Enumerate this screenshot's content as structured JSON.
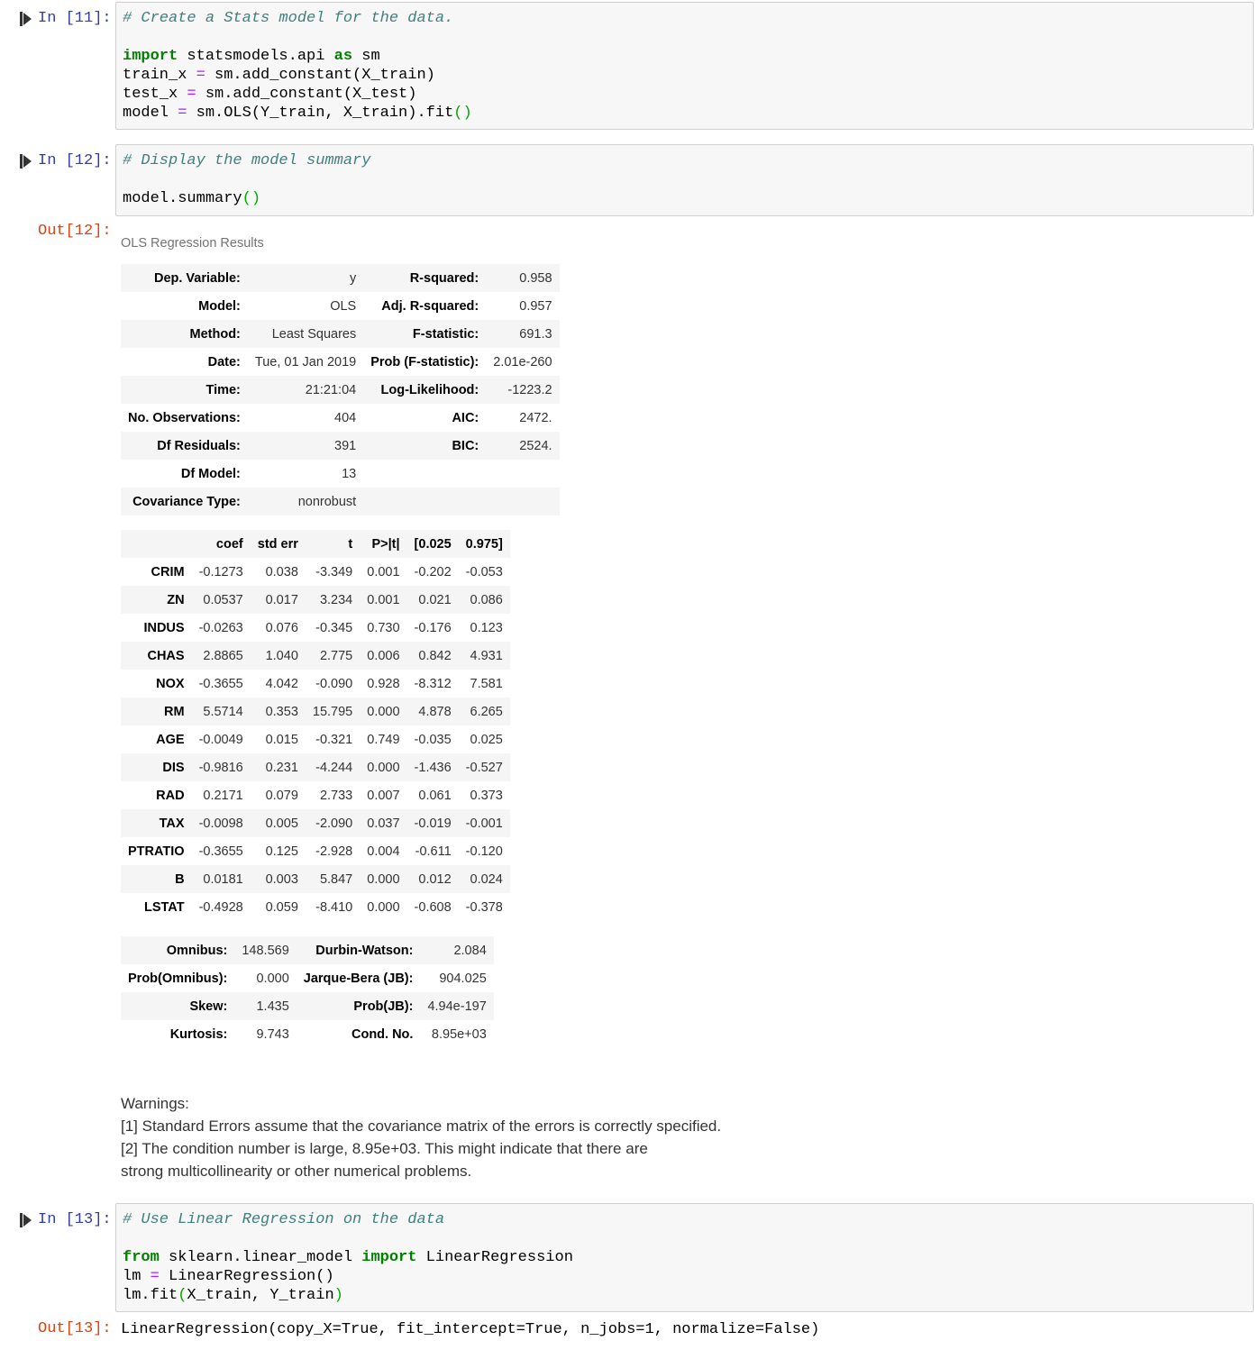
{
  "cells": {
    "c11": {
      "prompt": "In [11]:",
      "lines": [
        {
          "segments": [
            {
              "t": "# Create a Stats model for the data.",
              "c": "cm-comment"
            }
          ]
        },
        {
          "segments": []
        },
        {
          "segments": [
            {
              "t": "import",
              "c": "cm-kw"
            },
            {
              "t": " statsmodels.api ",
              "c": ""
            },
            {
              "t": "as",
              "c": "cm-kw"
            },
            {
              "t": " sm",
              "c": ""
            }
          ]
        },
        {
          "segments": [
            {
              "t": "train_x ",
              "c": ""
            },
            {
              "t": "=",
              "c": "cm-op"
            },
            {
              "t": " sm.add_constant(X_train)",
              "c": ""
            }
          ]
        },
        {
          "segments": [
            {
              "t": "test_x ",
              "c": ""
            },
            {
              "t": "=",
              "c": "cm-op"
            },
            {
              "t": " sm.add_constant(X_test)",
              "c": ""
            }
          ]
        },
        {
          "segments": [
            {
              "t": "model ",
              "c": ""
            },
            {
              "t": "=",
              "c": "cm-op"
            },
            {
              "t": " sm.OLS(Y_train, X_train).fit",
              "c": ""
            },
            {
              "t": "()",
              "c": "cm-bracket"
            }
          ]
        }
      ]
    },
    "c12": {
      "prompt": "In [12]:",
      "out_prompt": "Out[12]:",
      "lines": [
        {
          "segments": [
            {
              "t": "# Display the model summary",
              "c": "cm-comment"
            }
          ]
        },
        {
          "segments": []
        },
        {
          "segments": [
            {
              "t": "model.summary",
              "c": ""
            },
            {
              "t": "()",
              "c": "cm-bracket"
            }
          ]
        }
      ]
    },
    "c13": {
      "prompt": "In [13]:",
      "out_prompt": "Out[13]:",
      "lines": [
        {
          "segments": [
            {
              "t": "# Use Linear Regression on the data",
              "c": "cm-comment"
            }
          ]
        },
        {
          "segments": []
        },
        {
          "segments": [
            {
              "t": "from",
              "c": "cm-kw"
            },
            {
              "t": " sklearn.linear_model ",
              "c": ""
            },
            {
              "t": "import",
              "c": "cm-kw"
            },
            {
              "t": " LinearRegression",
              "c": ""
            }
          ]
        },
        {
          "segments": [
            {
              "t": "lm ",
              "c": ""
            },
            {
              "t": "=",
              "c": "cm-op"
            },
            {
              "t": " LinearRegression()",
              "c": ""
            }
          ]
        },
        {
          "segments": [
            {
              "t": "lm.fit",
              "c": ""
            },
            {
              "t": "(",
              "c": "cm-bracket"
            },
            {
              "t": "X_train, Y_train",
              "c": ""
            },
            {
              "t": ")",
              "c": "cm-bracket"
            }
          ]
        }
      ],
      "output": "LinearRegression(copy_X=True, fit_intercept=True, n_jobs=1, normalize=False)"
    }
  },
  "summary": {
    "caption": "OLS Regression Results",
    "top_table": [
      [
        "Dep. Variable:",
        "y",
        "R-squared:",
        "0.958"
      ],
      [
        "Model:",
        "OLS",
        "Adj. R-squared:",
        "0.957"
      ],
      [
        "Method:",
        "Least Squares",
        "F-statistic:",
        "691.3"
      ],
      [
        "Date:",
        "Tue, 01 Jan 2019",
        "Prob (F-statistic):",
        "2.01e-260"
      ],
      [
        "Time:",
        "21:21:04",
        "Log-Likelihood:",
        "-1223.2"
      ],
      [
        "No. Observations:",
        "404",
        "AIC:",
        "2472."
      ],
      [
        "Df Residuals:",
        "391",
        "BIC:",
        "2524."
      ],
      [
        "Df Model:",
        "13",
        "",
        ""
      ],
      [
        "Covariance Type:",
        "nonrobust",
        "",
        ""
      ]
    ],
    "coef_headers": [
      "",
      "coef",
      "std err",
      "t",
      "P>|t|",
      "[0.025",
      "0.975]"
    ],
    "coef_rows": [
      [
        "CRIM",
        "-0.1273",
        "0.038",
        "-3.349",
        "0.001",
        "-0.202",
        "-0.053"
      ],
      [
        "ZN",
        "0.0537",
        "0.017",
        "3.234",
        "0.001",
        "0.021",
        "0.086"
      ],
      [
        "INDUS",
        "-0.0263",
        "0.076",
        "-0.345",
        "0.730",
        "-0.176",
        "0.123"
      ],
      [
        "CHAS",
        "2.8865",
        "1.040",
        "2.775",
        "0.006",
        "0.842",
        "4.931"
      ],
      [
        "NOX",
        "-0.3655",
        "4.042",
        "-0.090",
        "0.928",
        "-8.312",
        "7.581"
      ],
      [
        "RM",
        "5.5714",
        "0.353",
        "15.795",
        "0.000",
        "4.878",
        "6.265"
      ],
      [
        "AGE",
        "-0.0049",
        "0.015",
        "-0.321",
        "0.749",
        "-0.035",
        "0.025"
      ],
      [
        "DIS",
        "-0.9816",
        "0.231",
        "-4.244",
        "0.000",
        "-1.436",
        "-0.527"
      ],
      [
        "RAD",
        "0.2171",
        "0.079",
        "2.733",
        "0.007",
        "0.061",
        "0.373"
      ],
      [
        "TAX",
        "-0.0098",
        "0.005",
        "-2.090",
        "0.037",
        "-0.019",
        "-0.001"
      ],
      [
        "PTRATIO",
        "-0.3655",
        "0.125",
        "-2.928",
        "0.004",
        "-0.611",
        "-0.120"
      ],
      [
        "B",
        "0.0181",
        "0.003",
        "5.847",
        "0.000",
        "0.012",
        "0.024"
      ],
      [
        "LSTAT",
        "-0.4928",
        "0.059",
        "-8.410",
        "0.000",
        "-0.608",
        "-0.378"
      ]
    ],
    "bottom_table": [
      [
        "Omnibus:",
        "148.569",
        "Durbin-Watson:",
        "2.084"
      ],
      [
        "Prob(Omnibus):",
        "0.000",
        "Jarque-Bera (JB):",
        "904.025"
      ],
      [
        "Skew:",
        "1.435",
        "Prob(JB):",
        "4.94e-197"
      ],
      [
        "Kurtosis:",
        "9.743",
        "Cond. No.",
        "8.95e+03"
      ]
    ],
    "warnings": [
      "Warnings:",
      "[1] Standard Errors assume that the covariance matrix of the errors is correctly specified.",
      "[2] The condition number is large, 8.95e+03. This might indicate that there are",
      "strong multicollinearity or other numerical problems."
    ]
  },
  "icons": {
    "run": "run-cell-icon"
  }
}
